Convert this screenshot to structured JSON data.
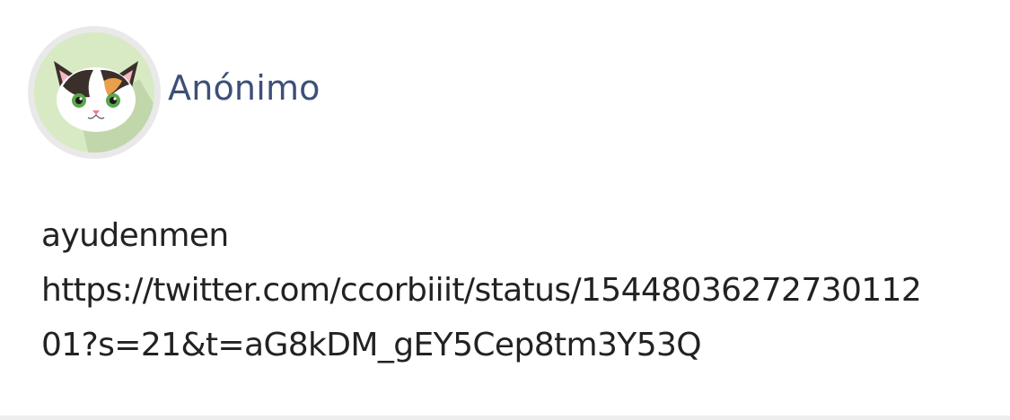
{
  "post": {
    "author": {
      "name": "Anónimo",
      "avatar_icon": "calico-cat-face-icon"
    },
    "message": {
      "text": "ayudenmen",
      "link_line_1": "https://twitter.com/ccorbiiit/status/15448036272730112",
      "link_line_2": "01?s=21&t=aG8kDM_gEY5Cep8tm3Y53Q"
    }
  },
  "colors": {
    "username": "#3d4f7a",
    "text": "#222222",
    "avatar_ring": "#e9e9e9",
    "avatar_background": "#d8eac3",
    "avatar_shadow": "#c2d6ac"
  }
}
